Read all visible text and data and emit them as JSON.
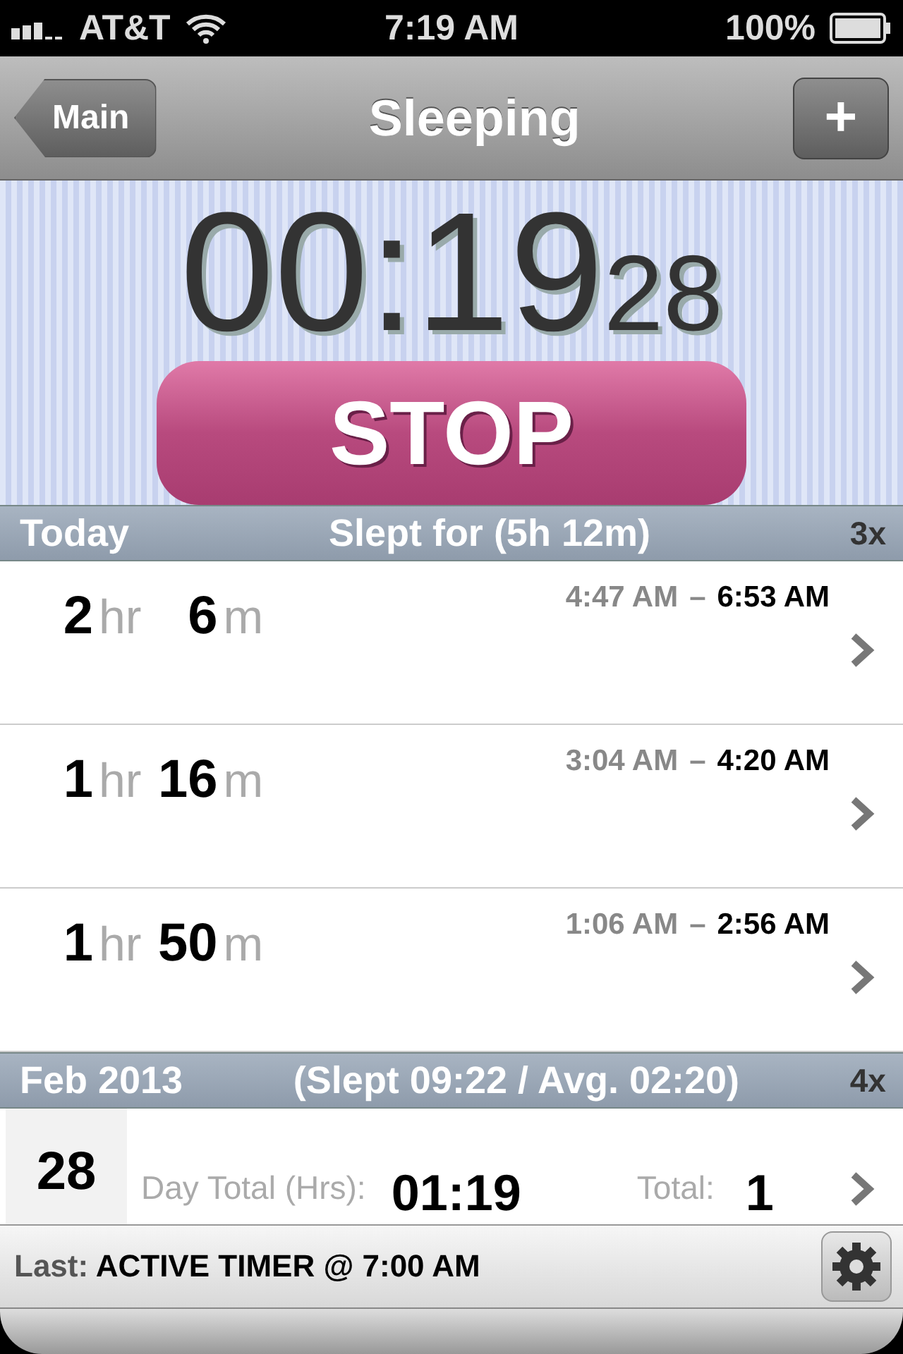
{
  "status_bar": {
    "carrier": "AT&T",
    "time": "7:19 AM",
    "battery": "100%"
  },
  "nav": {
    "back": "Main",
    "title": "Sleeping",
    "add": "+"
  },
  "timer": {
    "main": "00:19",
    "seconds": "28",
    "button": "STOP"
  },
  "today": {
    "label": "Today",
    "summary": "Slept for (5h 12m)",
    "count": "3x",
    "rows": [
      {
        "hours": "2",
        "hr_unit": "hr",
        "minutes": "6",
        "min_unit": "m",
        "start": "4:47 AM",
        "dash": "–",
        "end": "6:53 AM"
      },
      {
        "hours": "1",
        "hr_unit": "hr",
        "minutes": "16",
        "min_unit": "m",
        "start": "3:04 AM",
        "dash": "–",
        "end": "4:20 AM"
      },
      {
        "hours": "1",
        "hr_unit": "hr",
        "minutes": "50",
        "min_unit": "m",
        "start": "1:06 AM",
        "dash": "–",
        "end": "2:56 AM"
      }
    ]
  },
  "month": {
    "label": "Feb 2013",
    "summary": "(Slept 09:22 / Avg. 02:20)",
    "count": "4x",
    "rows": [
      {
        "day": "28",
        "day_total_label": "Day Total (Hrs):",
        "day_total": "01:19",
        "total_label": "Total:",
        "total": "1"
      }
    ]
  },
  "footer": {
    "label": "Last:",
    "value": "ACTIVE TIMER @ 7:00 AM"
  }
}
